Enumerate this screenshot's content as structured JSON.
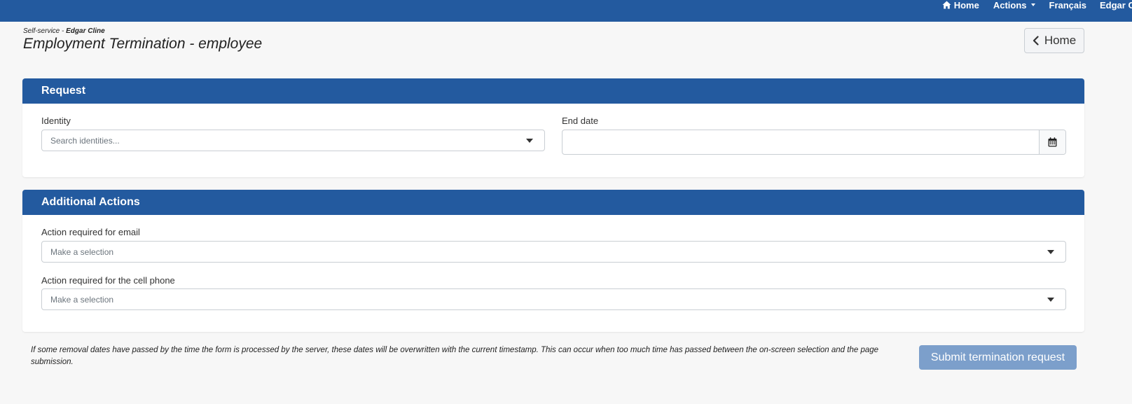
{
  "topbar": {
    "home_label": "Home",
    "actions_label": "Actions",
    "language_label": "Français",
    "user_label": "Edgar Cline",
    "bg_color": "#235a9f"
  },
  "header": {
    "breadcrumb_prefix": "Self-service - ",
    "breadcrumb_user": "Edgar Cline",
    "title": "Employment Termination - employee",
    "home_button_label": "Home"
  },
  "request": {
    "title": "Request",
    "identity_label": "Identity",
    "identity_placeholder": "Search identities...",
    "end_date_label": "End date",
    "end_date_value": ""
  },
  "additional_actions": {
    "title": "Additional Actions",
    "email_label": "Action required for email",
    "email_placeholder": "Make a selection",
    "cell_label": "Action required for the cell phone",
    "cell_placeholder": "Make a selection"
  },
  "footer": {
    "notice": "If some removal dates have passed by the time the form is processed by the server, these dates will be overwritten with the current timestamp. This can occur when too much time has passed between the on-screen selection and the page submission.",
    "submit_label": "Submit termination request",
    "submit_color": "#7c9fcb"
  },
  "icons": {
    "home": "home-icon",
    "caret": "caret-down-icon",
    "chevron": "chevron-left-icon",
    "calendar": "calendar-icon"
  }
}
